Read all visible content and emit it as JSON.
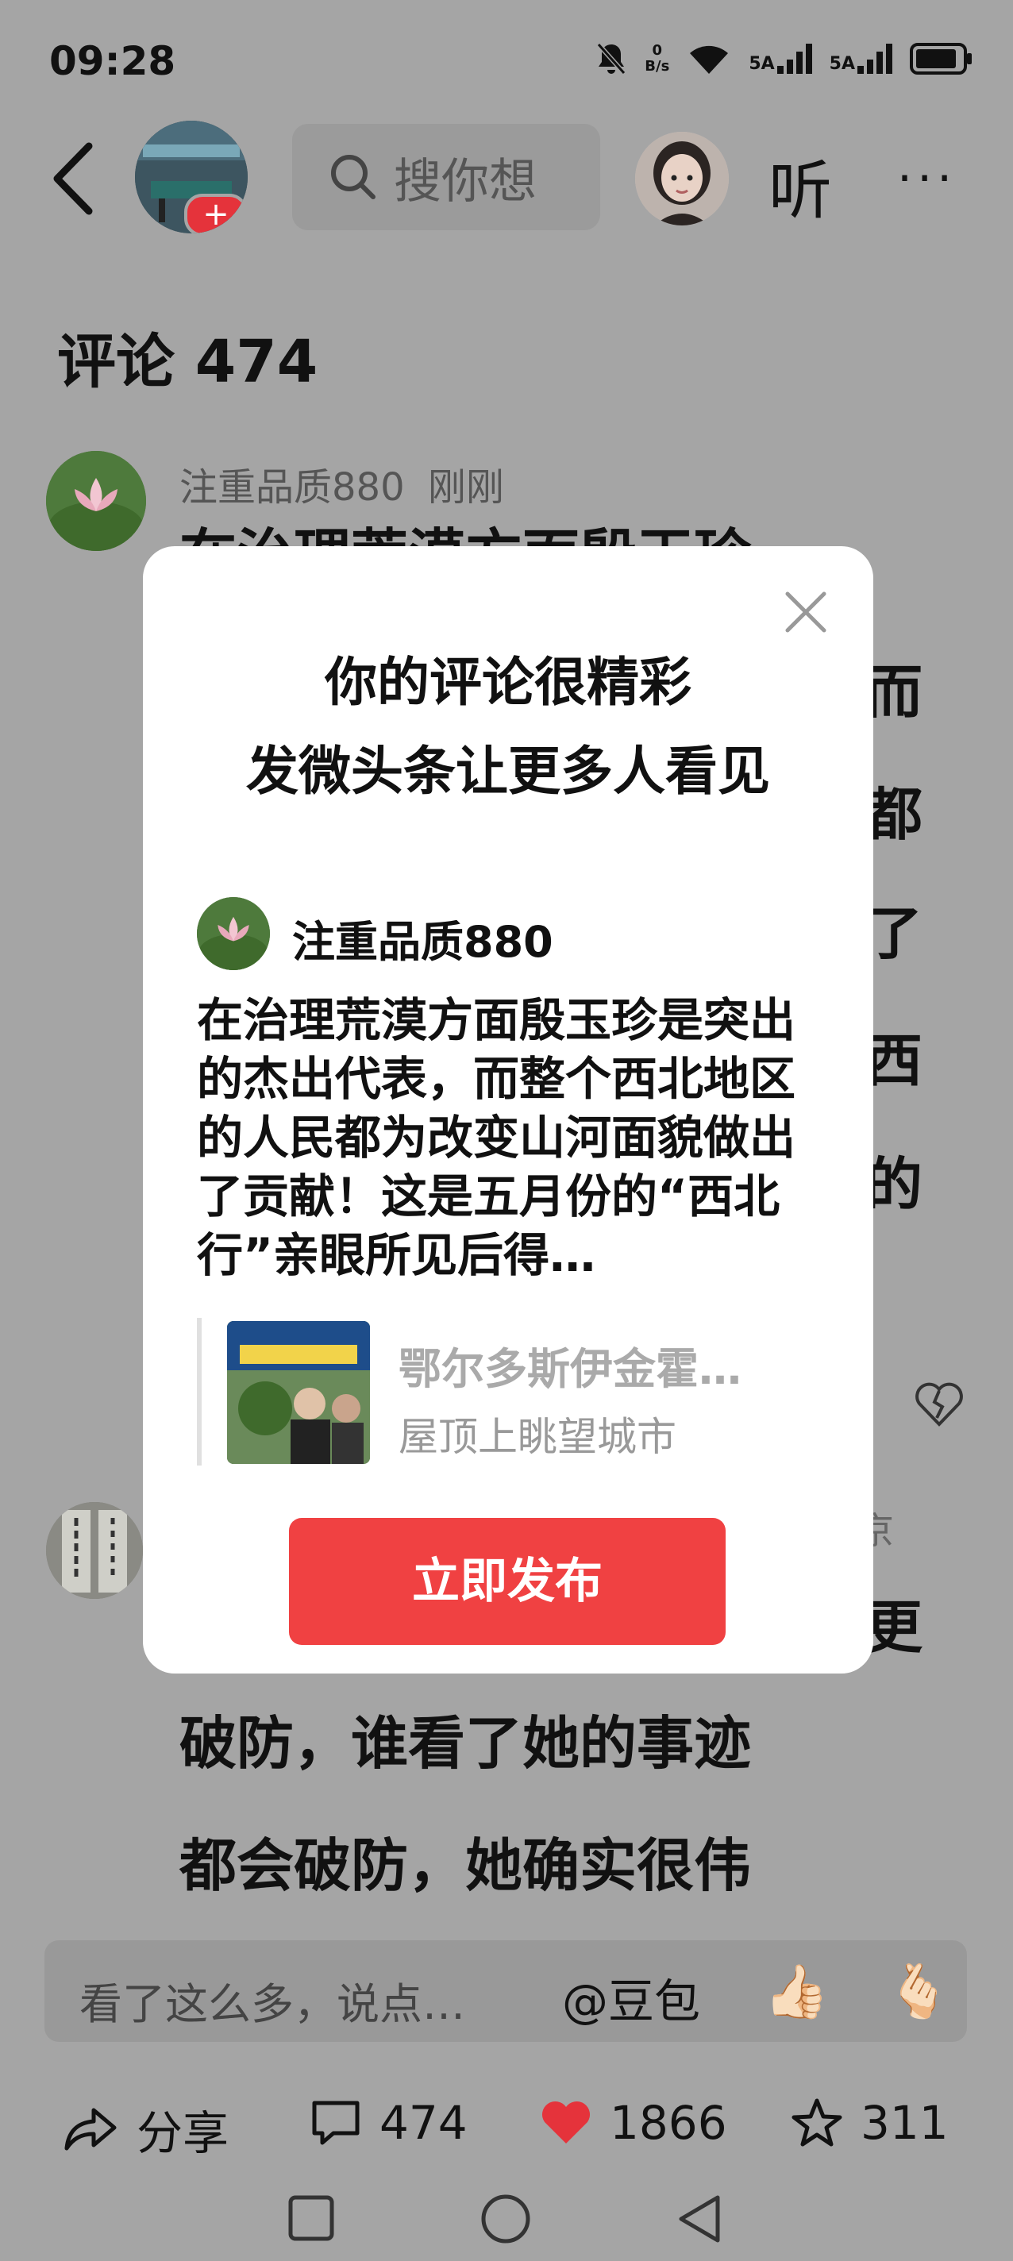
{
  "status_bar": {
    "time": "09:28",
    "net_speed_value": "0",
    "net_speed_unit": "B/s",
    "signal1": "5A",
    "signal2": "5A"
  },
  "nav": {
    "search_placeholder": "搜你想",
    "listen_label": "听",
    "more_label": "···"
  },
  "comments_title": "评论 474",
  "comment1": {
    "user": "注重品质880",
    "time": "刚刚",
    "bg_lines": [
      "在治理荒漠方面殷玉珍",
      "而",
      "都",
      "了",
      "西",
      "的"
    ]
  },
  "comment2": {
    "meta_tail": "京",
    "bg_lines": [
      "更",
      "破防，谁看了她的事迹",
      "都会破防，她确实很伟"
    ]
  },
  "input_bar": {
    "placeholder": "看了这么多，说点…",
    "mention": "@豆包",
    "emoji1": "👍🏻",
    "emoji2": "🫰🏻"
  },
  "actions": {
    "share": "分享",
    "comments": "474",
    "likes": "1866",
    "favorites": "311"
  },
  "modal": {
    "title1": "你的评论很精彩",
    "title2": "发微头条让更多人看见",
    "user": "注重品质880",
    "body": "在治理荒漠方面殷玉珍是突出的杰出代表，而整个西北地区的人民都为改变山河面貌做出了贡献！这是五月份的“西北行”亲眼所见后得…",
    "quote_title": "鄂尔多斯伊金霍…",
    "quote_sub": "屋顶上眺望城市",
    "publish_button": "立即发布"
  },
  "colors": {
    "accent_red": "#f04142",
    "like_red": "#e5333b"
  }
}
